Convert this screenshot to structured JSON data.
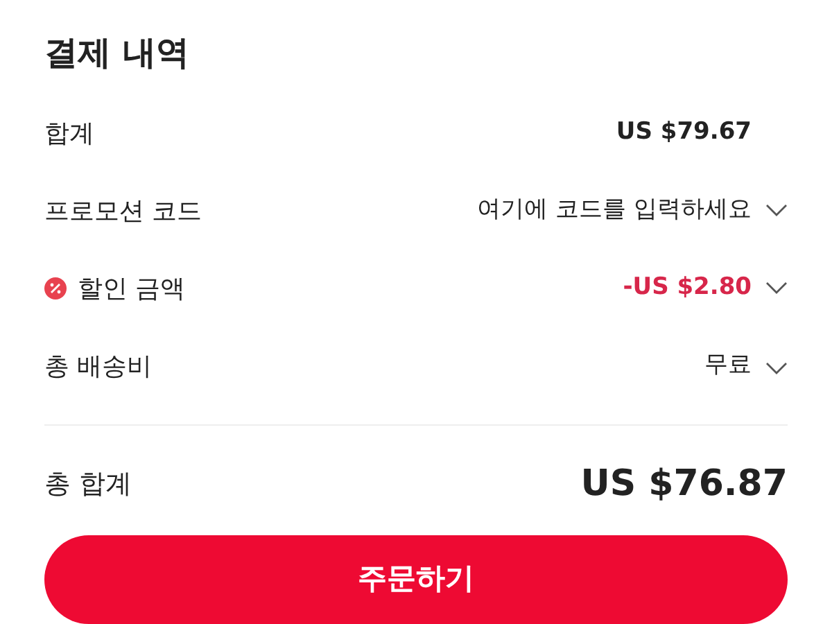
{
  "title": "결제 내역",
  "rows": [
    {
      "kind": "subtotal",
      "label": "합계",
      "value": "US $79.67"
    },
    {
      "kind": "promo",
      "label": "프로모션 코드",
      "value": "여기에 코드를 입력하세요"
    },
    {
      "kind": "discount",
      "label": "할인 금액",
      "value": "-US $2.80"
    },
    {
      "kind": "shipping",
      "label": "총 배송비",
      "value": "무료"
    }
  ],
  "total": {
    "label": "총 합계",
    "value": "US $76.87"
  },
  "button": "주문하기"
}
